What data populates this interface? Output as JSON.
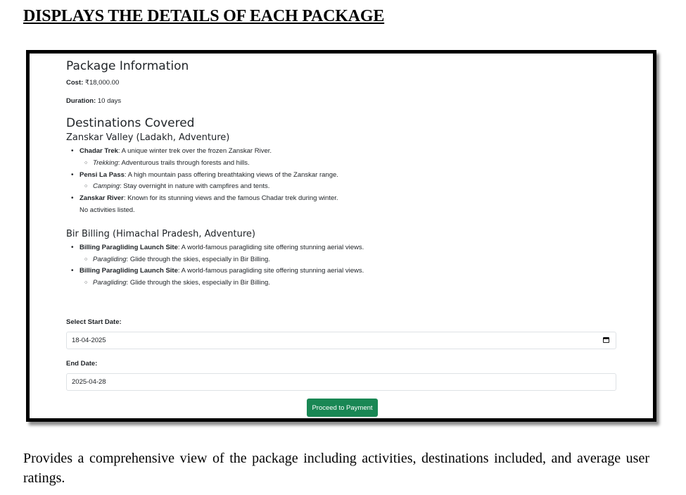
{
  "doc": {
    "heading": "DISPLAYS THE DETAILS OF EACH PACKAGE",
    "caption": "Provides a comprehensive view of the package including activities, destinations included, and average user ratings."
  },
  "package": {
    "info_title": "Package Information",
    "cost_label": "Cost:",
    "cost_value": "₹18,000.00",
    "duration_label": "Duration:",
    "duration_value": "10 days",
    "destinations_title": "Destinations Covered"
  },
  "destinations": [
    {
      "title": "Zanskar Valley (Ladakh, Adventure)",
      "places": [
        {
          "name": "Chadar Trek",
          "desc": ": A unique winter trek over the frozen Zanskar River.",
          "activity": "Trekking",
          "activity_desc": ": Adventurous trails through forests and hills."
        },
        {
          "name": "Pensi La Pass",
          "desc": ": A high mountain pass offering breathtaking views of the Zanskar range.",
          "activity": "Camping",
          "activity_desc": ": Stay overnight in nature with campfires and tents."
        },
        {
          "name": "Zanskar River",
          "desc": ": Known for its stunning views and the famous Chadar trek during winter.",
          "no_activities": "No activities listed."
        }
      ]
    },
    {
      "title": "Bir Billing (Himachal Pradesh, Adventure)",
      "places": [
        {
          "name": "Billing Paragliding Launch Site",
          "desc": ": A world-famous paragliding site offering stunning aerial views.",
          "activity": "Paragliding",
          "activity_desc": ": Glide through the skies, especially in Bir Billing."
        },
        {
          "name": "Billing Paragliding Launch Site",
          "desc": ": A world-famous paragliding site offering stunning aerial views.",
          "activity": "Paragliding",
          "activity_desc": ": Glide through the skies, especially in Bir Billing."
        }
      ]
    }
  ],
  "form": {
    "start_label": "Select Start Date:",
    "start_value": "18-04-2025",
    "end_label": "End Date:",
    "end_value": "2025-04-28",
    "calendar_icon": "calendar-icon",
    "pay_button": "Proceed to Payment",
    "pay_button_color": "#198754"
  }
}
